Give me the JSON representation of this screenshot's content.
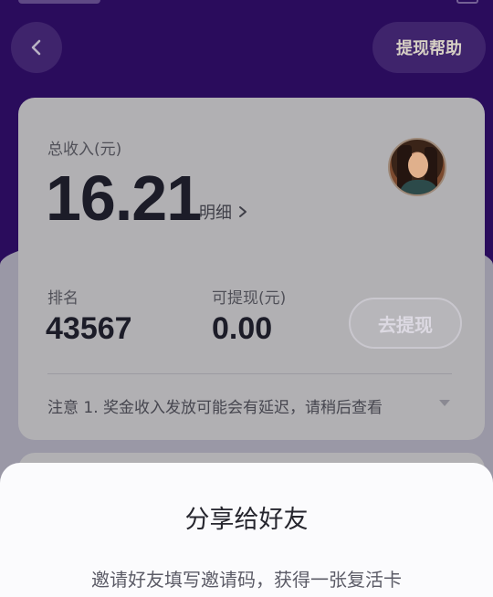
{
  "header": {
    "help_label": "提现帮助"
  },
  "card": {
    "total_income_label": "总收入(元)",
    "total_income_value": "16.21",
    "detail_label": "明细",
    "rank_label": "排名",
    "rank_value": "43567",
    "withdrawable_label": "可提现(元)",
    "withdrawable_value": "0.00",
    "withdraw_button_label": "去提现",
    "notice_text": "注意 1. 奖金收入发放可能会有延迟，请稍后查看"
  },
  "share_sheet": {
    "title": "分享给好友",
    "description": "邀请好友填写邀请码，获得一张复活卡"
  },
  "icons": {
    "back": "chevron-left-icon",
    "detail": "chevron-right-icon",
    "notice_toggle": "caret-down-icon"
  },
  "colors": {
    "header_bg": "#2a0c5c",
    "overlay_bg": "#9a98a6",
    "card_bg": "#b1b0b3",
    "sheet_bg": "#fbfbfd"
  }
}
